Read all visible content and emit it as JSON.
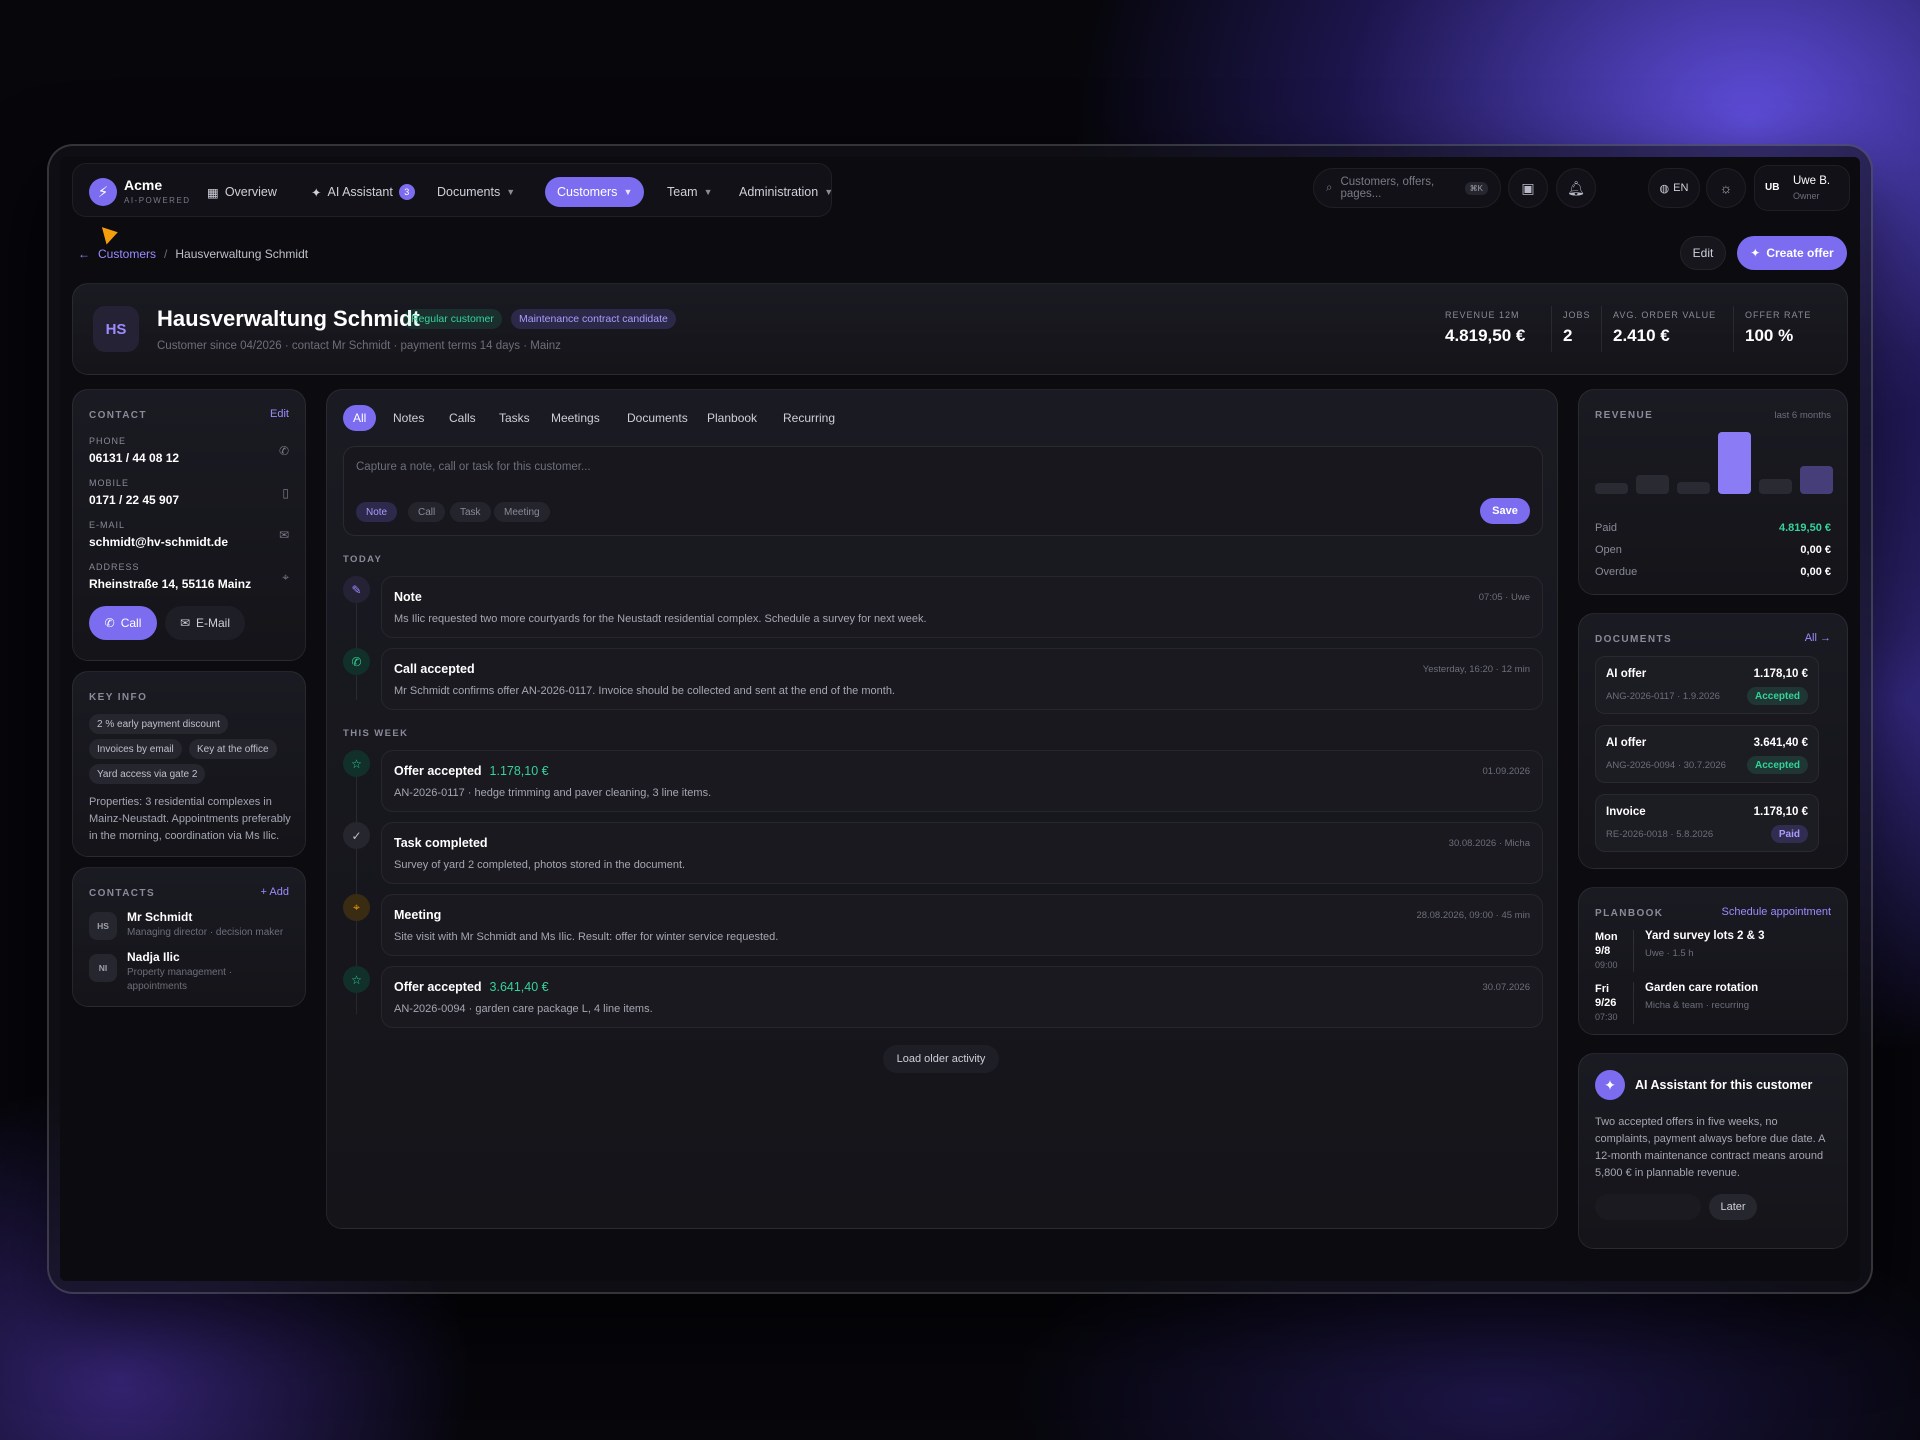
{
  "brand": {
    "name": "Acme",
    "tagline": "AI-POWERED"
  },
  "nav": {
    "overview": "Overview",
    "ai_assistant": "AI Assistant",
    "ai_count": "3",
    "documents": "Documents",
    "customers": "Customers",
    "team": "Team",
    "administration": "Administration"
  },
  "search": {
    "placeholder": "Customers, offers, pages...",
    "shortcut": "⌘K"
  },
  "lang": "EN",
  "user": {
    "initials": "UB",
    "name": "Uwe B.",
    "role": "Owner"
  },
  "breadcrumb": {
    "parent": "Customers",
    "current": "Hausverwaltung Schmidt"
  },
  "actions": {
    "edit": "Edit",
    "create_offer": "Create offer"
  },
  "customer": {
    "initials": "HS",
    "name": "Hausverwaltung Schmidt",
    "tag1": "Regular customer",
    "tag2": "Maintenance contract candidate",
    "subtitle": "Customer since 04/2026 · contact Mr Schmidt · payment terms 14 days · Mainz"
  },
  "kpis": [
    {
      "label": "REVENUE 12M",
      "value": "4.819,50 €"
    },
    {
      "label": "JOBS",
      "value": "2"
    },
    {
      "label": "AVG. ORDER VALUE",
      "value": "2.410 €"
    },
    {
      "label": "OFFER RATE",
      "value": "100 %"
    }
  ],
  "contact": {
    "title": "CONTACT",
    "edit": "Edit",
    "phone_label": "PHONE",
    "phone": "06131 / 44 08 12",
    "mobile_label": "MOBILE",
    "mobile": "0171 / 22 45 907",
    "email_label": "E-MAIL",
    "email": "schmidt@hv-schmidt.de",
    "address_label": "ADDRESS",
    "address": "Rheinstraße 14, 55116 Mainz",
    "call": "Call",
    "mail": "E-Mail"
  },
  "key_info": {
    "title": "KEY INFO",
    "chips": [
      "2 % early payment discount",
      "Invoices by email",
      "Key at the office",
      "Yard access via gate 2"
    ],
    "text": "Properties: 3 residential complexes in Mainz-Neustadt. Appointments preferably in the morning, coordination via Ms Ilic."
  },
  "contacts": {
    "title": "CONTACTS",
    "add": "+ Add",
    "items": [
      {
        "initials": "HS",
        "name": "Mr Schmidt",
        "role": "Managing director · decision maker"
      },
      {
        "initials": "NI",
        "name": "Nadja Ilic",
        "role": "Property management · appointments"
      }
    ]
  },
  "tabs": [
    "All",
    "Notes",
    "Calls",
    "Tasks",
    "Meetings",
    "Documents",
    "Planbook",
    "Recurring"
  ],
  "composer": {
    "placeholder": "Capture a note, call or task for this customer...",
    "types": [
      "Note",
      "Call",
      "Task",
      "Meeting"
    ],
    "save": "Save"
  },
  "activity": {
    "today_label": "TODAY",
    "week_label": "THIS WEEK",
    "today": [
      {
        "title": "Note",
        "amount": "",
        "desc": "Ms Ilic requested two more courtyards for the Neustadt residential complex. Schedule a survey for next week.",
        "meta": "07:05 · Uwe",
        "icon": "pencil-icon"
      },
      {
        "title": "Call accepted",
        "amount": "",
        "desc": "Mr Schmidt confirms offer AN-2026-0117. Invoice should be collected and sent at the end of the month.",
        "meta": "Yesterday, 16:20 · 12 min",
        "icon": "phone-icon"
      }
    ],
    "week": [
      {
        "title": "Offer accepted",
        "amount": "1.178,10 €",
        "desc": "AN-2026-0117 · hedge trimming and paver cleaning, 3 line items.",
        "meta": "01.09.2026",
        "icon": "star-icon"
      },
      {
        "title": "Task completed",
        "amount": "",
        "desc": "Survey of yard 2 completed, photos stored in the document.",
        "meta": "30.08.2026 · Micha",
        "icon": "check-icon"
      },
      {
        "title": "Meeting",
        "amount": "",
        "desc": "Site visit with Mr Schmidt and Ms Ilic. Result: offer for winter service requested.",
        "meta": "28.08.2026, 09:00 · 45 min",
        "icon": "location-pin-icon"
      },
      {
        "title": "Offer accepted",
        "amount": "3.641,40 €",
        "desc": "AN-2026-0094 · garden care package L, 4 line items.",
        "meta": "30.07.2026",
        "icon": "star-icon"
      }
    ],
    "load_older": "Load older activity"
  },
  "revenue": {
    "title": "REVENUE",
    "period": "last 6 months",
    "bars": [
      0.17,
      0.3,
      0.2,
      1.0,
      0.25,
      0.45
    ],
    "highlight_index": 3,
    "paid_label": "Paid",
    "paid": "4.819,50 €",
    "open_label": "Open",
    "open": "0,00 €",
    "overdue_label": "Overdue",
    "overdue": "0,00 €"
  },
  "documents": {
    "title": "DOCUMENTS",
    "all": "All →",
    "items": [
      {
        "title": "AI offer",
        "amount": "1.178,10 €",
        "ref": "ANG-2026-0117 · 1.9.2026",
        "status": "Accepted",
        "kind": "acc"
      },
      {
        "title": "AI offer",
        "amount": "3.641,40 €",
        "ref": "ANG-2026-0094 · 30.7.2026",
        "status": "Accepted",
        "kind": "acc"
      },
      {
        "title": "Invoice",
        "amount": "1.178,10 €",
        "ref": "RE-2026-0018 · 5.8.2026",
        "status": "Paid",
        "kind": "paid"
      }
    ]
  },
  "planbook": {
    "title": "PLANBOOK",
    "schedule": "Schedule appointment",
    "items": [
      {
        "day": "Mon",
        "date": "9/8",
        "time": "09:00",
        "title": "Yard survey lots 2 & 3",
        "sub": "Uwe · 1.5 h"
      },
      {
        "day": "Fri",
        "date": "9/26",
        "time": "07:30",
        "title": "Garden care rotation",
        "sub": "Micha & team · recurring"
      }
    ]
  },
  "ai": {
    "title": "AI Assistant for this customer",
    "text": "Two accepted offers in five weeks, no complaints, payment always before due date. A 12-month maintenance contract means around 5,800 € in plannable revenue.",
    "later": "Later"
  },
  "colors": {
    "accent": "#7c6cf0",
    "success": "#34d399",
    "warning": "#f59e0b",
    "background": "#0b0b10"
  }
}
